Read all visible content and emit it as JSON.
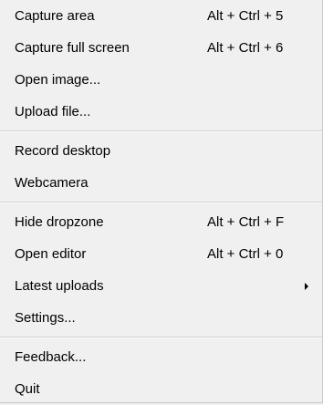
{
  "menu": {
    "groups": [
      {
        "items": [
          {
            "label": "Capture area",
            "shortcut": "Alt + Ctrl + 5"
          },
          {
            "label": "Capture full screen",
            "shortcut": "Alt + Ctrl + 6"
          },
          {
            "label": "Open image...",
            "shortcut": ""
          },
          {
            "label": "Upload file...",
            "shortcut": ""
          }
        ]
      },
      {
        "items": [
          {
            "label": "Record desktop",
            "shortcut": ""
          },
          {
            "label": "Webcamera",
            "shortcut": ""
          }
        ]
      },
      {
        "items": [
          {
            "label": "Hide dropzone",
            "shortcut": "Alt + Ctrl + F"
          },
          {
            "label": "Open editor",
            "shortcut": "Alt + Ctrl + 0"
          },
          {
            "label": "Latest uploads",
            "shortcut": "",
            "submenu": true
          },
          {
            "label": "Settings...",
            "shortcut": ""
          }
        ]
      },
      {
        "items": [
          {
            "label": "Feedback...",
            "shortcut": ""
          },
          {
            "label": "Quit",
            "shortcut": ""
          }
        ]
      }
    ]
  }
}
